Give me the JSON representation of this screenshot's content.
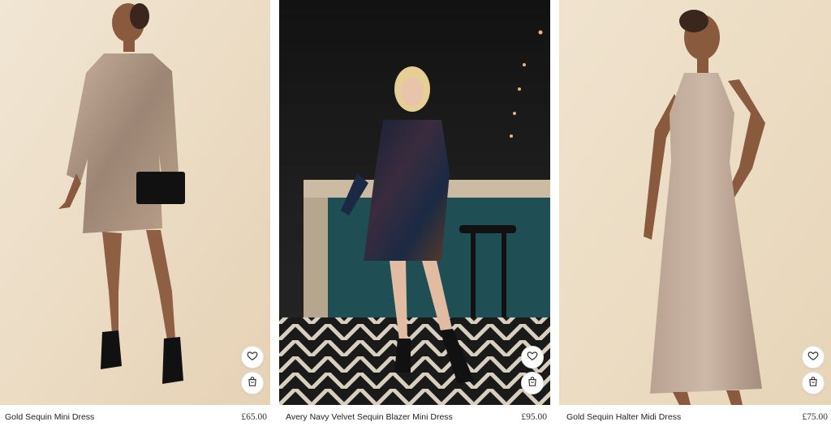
{
  "products": [
    {
      "name": "Gold Sequin Mini Dress",
      "price": "£65.00"
    },
    {
      "name": "Avery Navy Velvet Sequin Blazer Mini Dress",
      "price": "£95.00"
    },
    {
      "name": "Gold Sequin Halter Midi Dress",
      "price": "£75.00"
    }
  ],
  "icons": {
    "wishlist": "heart-icon",
    "add_to_bag": "shopping-bag-icon"
  },
  "colors": {
    "background": "#ffffff",
    "text": "#222222",
    "studio_backdrop": "#ecdcc4",
    "scene_dark": "#1c1c1c"
  }
}
